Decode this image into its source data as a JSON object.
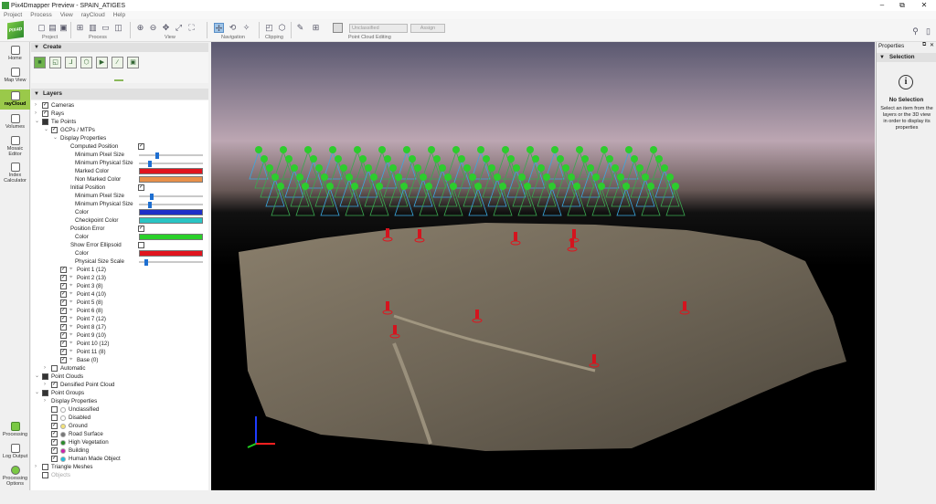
{
  "window": {
    "title": "Pix4Dmapper Preview - SPAIN_ATIGES",
    "minimize": "–",
    "maximize": "⧉",
    "close": "✕"
  },
  "menu": [
    "Project",
    "Process",
    "View",
    "rayCloud",
    "Help"
  ],
  "toolbar": {
    "groups": [
      "Project",
      "Process",
      "View",
      "Navigation",
      "Clipping",
      "Point Cloud Editing"
    ],
    "class_dropdown": "Unclassified",
    "assign_label": "Assign",
    "logo": "PIX4D"
  },
  "leftnav": [
    {
      "name": "home",
      "label": "Home"
    },
    {
      "name": "map-view",
      "label": "Map View"
    },
    {
      "name": "raycloud",
      "label": "rayCloud"
    },
    {
      "name": "volumes",
      "label": "Volumes"
    },
    {
      "name": "mosaic-editor",
      "label": "Mosaic Editor"
    },
    {
      "name": "index-calculator",
      "label": "Index Calculator"
    },
    {
      "name": "processing",
      "label": "Processing"
    },
    {
      "name": "log-output",
      "label": "Log Output"
    },
    {
      "name": "processing-options",
      "label": "Processing Options"
    }
  ],
  "create": {
    "title": "Create"
  },
  "layers": {
    "title": "Layers"
  },
  "tree": {
    "cameras": "Cameras",
    "rays": "Rays",
    "tie_points": "Tie Points",
    "gcps": "GCPs / MTPs",
    "display_properties": "Display Properties",
    "computed_position": "Computed Position",
    "min_pixel_size": "Minimum Pixel Size",
    "min_physical_size": "Minimum Physical Size",
    "marked_color": "Marked Color",
    "non_marked_color": "Non Marked Color",
    "initial_position": "Initial Position",
    "min_pixel_size2": "Minimum Pixel Size",
    "min_physical_size2": "Minimum Physical Size",
    "color": "Color",
    "checkpoint_color": "Checkpoint Color",
    "position_error": "Position Error",
    "color2": "Color",
    "show_error_ellipsoid": "Show Error Ellipsoid",
    "color3": "Color",
    "physical_size_scale": "Physical Size Scale",
    "points": [
      "Point 1 (12)",
      "Point 2 (13)",
      "Point 3 (8)",
      "Point 4 (10)",
      "Point 5 (8)",
      "Point 6 (8)",
      "Point 7 (12)",
      "Point 8 (17)",
      "Point 9 (10)",
      "Point 10 (12)",
      "Point 11 (8)",
      "Base (0)"
    ],
    "automatic": "Automatic",
    "point_clouds": "Point Clouds",
    "densified_point_cloud": "Densified Point Cloud",
    "point_groups": "Point Groups",
    "pg_display_properties": "Display Properties",
    "groups": [
      {
        "label": "Unclassified",
        "color": "#ffffff"
      },
      {
        "label": "Disabled",
        "color": "#ffffff"
      },
      {
        "label": "Ground",
        "color": "#f2e27a"
      },
      {
        "label": "Road Surface",
        "color": "#777777"
      },
      {
        "label": "High Vegetation",
        "color": "#2a8a2a"
      },
      {
        "label": "Building",
        "color": "#cc22aa"
      },
      {
        "label": "Human Made Object",
        "color": "#22bbdd"
      }
    ],
    "triangle_meshes": "Triangle Meshes",
    "objects": "Objects"
  },
  "colors": {
    "marked": "#e0141e",
    "non_marked": "#e8904a",
    "initial": "#1d2ec8",
    "checkpoint": "#2ac4c4",
    "position_error": "#2ad02a",
    "ellipsoid": "#e0141e",
    "accent": "#9ac94a"
  },
  "properties": {
    "title": "Properties",
    "selection": "Selection",
    "no_selection": "No Selection",
    "hint": "Select an item from the layers or the 3D view in order to display its properties"
  }
}
